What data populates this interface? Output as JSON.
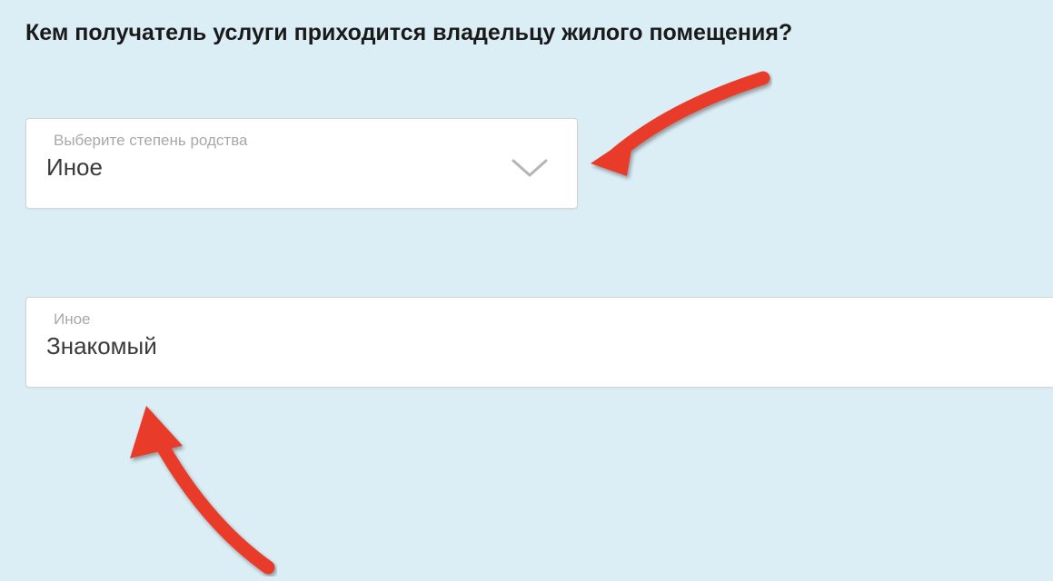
{
  "heading": "Кем получатель услуги приходится владельцу жилого помещения?",
  "select": {
    "label": "Выберите степень родства",
    "value": "Иное"
  },
  "textfield": {
    "label": "Иное",
    "value": "Знакомый"
  },
  "colors": {
    "arrow": "#e83b2a",
    "background": "#dbeef5",
    "chevron": "#b5b5b5"
  }
}
